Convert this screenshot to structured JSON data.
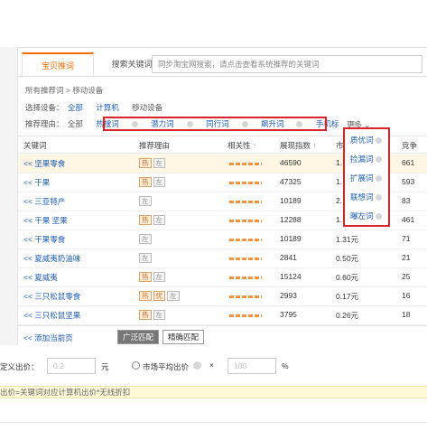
{
  "tabs": {
    "active": "宝贝推词",
    "other": "搜索关键词",
    "search_placeholder": "同步淘宝网搜索，请点击查看系统推荐的关键词"
  },
  "breadcrumb": {
    "root": "所有推荐词 >",
    "current": "移动设备"
  },
  "device": {
    "label": "选择设备：",
    "options": [
      "全部",
      "计算机",
      "移动设备"
    ]
  },
  "reason": {
    "label": "推荐理由：",
    "all": "全部",
    "options": [
      "热搜词",
      "潜力词",
      "同行词",
      "飙升词",
      "手机标"
    ],
    "more": "更多"
  },
  "more_menu": {
    "items": [
      "质优词",
      "捡漏词",
      "扩展词",
      "联想词",
      "曝左词"
    ]
  },
  "table": {
    "headers": {
      "keyword": "关键词",
      "reason": "推荐理由",
      "relevance": "相关性",
      "impressions": "展现指数",
      "price": "市场",
      "competition": "竞争"
    },
    "rows": [
      {
        "keyword": "<< 坚果零食",
        "tags": [
          "热",
          "左"
        ],
        "impressions": "46590",
        "price": "1.",
        "competition": "661"
      },
      {
        "keyword": "<< 干果",
        "tags": [
          "热",
          "左"
        ],
        "impressions": "47325",
        "price": "1.",
        "competition": "593"
      },
      {
        "keyword": "<< 三亚特产",
        "tags": [
          "左"
        ],
        "impressions": "10189",
        "price": "2.",
        "competition": "83"
      },
      {
        "keyword": "<< 干果 坚果",
        "tags": [
          "热",
          "左"
        ],
        "impressions": "12288",
        "price": "1.",
        "competition": "461"
      },
      {
        "keyword": "<< 干果零食",
        "tags": [
          "左"
        ],
        "impressions": "10189",
        "price": "1.31元",
        "competition": "71"
      },
      {
        "keyword": "<< 夏威夷奶油味",
        "tags": [
          "左"
        ],
        "impressions": "2841",
        "price": "0.50元",
        "competition": "21"
      },
      {
        "keyword": "<< 夏威夷",
        "tags": [
          "热",
          "左"
        ],
        "impressions": "15124",
        "price": "0.60元",
        "competition": "25"
      },
      {
        "keyword": "<< 三只松鼠零食",
        "tags": [
          "热",
          "优",
          "左"
        ],
        "impressions": "2993",
        "price": "0.17元",
        "competition": "16"
      },
      {
        "keyword": "<< 三只松鼠坚果",
        "tags": [
          "热",
          "左"
        ],
        "impressions": "3795",
        "price": "0.26元",
        "competition": "18"
      }
    ],
    "relevance_level": 1.0
  },
  "footer": {
    "add_page": "<< 添加当前页",
    "broad_match": "广泛匹配",
    "exact_match": "精确匹配"
  },
  "bid": {
    "label": "定义出价：",
    "value": "0.2",
    "unit": "元",
    "market_avg_label": "市场平均出价",
    "multiply": "×",
    "percent_value": "100",
    "percent_unit": "%"
  },
  "warning": "出价=关键词对应计算机出价*无线折扣"
}
